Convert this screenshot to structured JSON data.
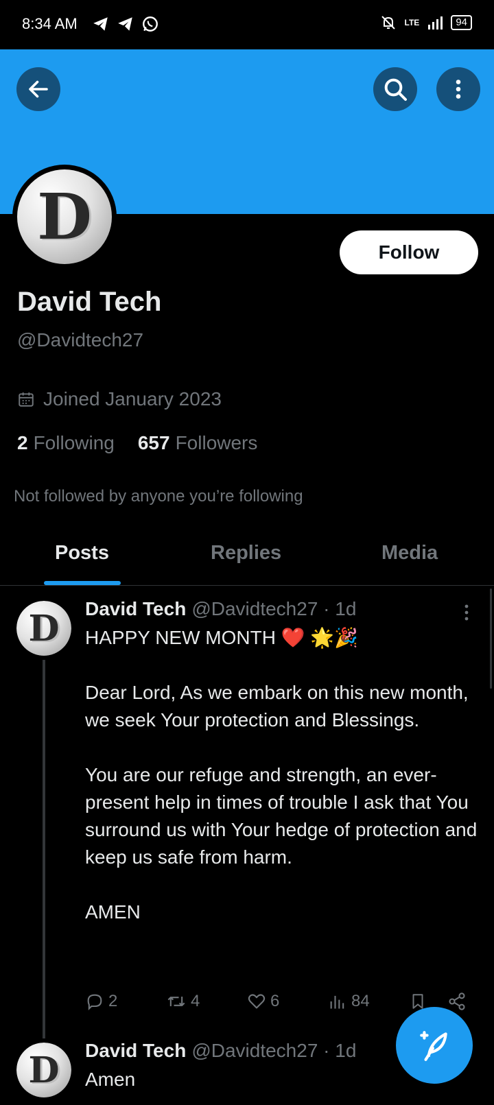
{
  "status_bar": {
    "time": "8:34 AM",
    "left_icons": [
      "telegram-icon",
      "telegram-icon",
      "whatsapp-icon"
    ],
    "right_icons": [
      "notifications-off-icon",
      "lte-signal-icon"
    ],
    "network": "LTE",
    "battery": "94"
  },
  "header": {
    "banner_color": "#1d9bf0",
    "back_icon": "arrow-left-icon",
    "search_icon": "search-icon",
    "more_icon": "more-vertical-icon"
  },
  "profile": {
    "avatar_letter": "D",
    "follow_label": "Follow",
    "name": "David Tech",
    "handle": "@Davidtech27",
    "joined": "Joined January 2023",
    "following_count": "2",
    "following_label": "Following",
    "followers_count": "657",
    "followers_label": "Followers",
    "not_followed": "Not followed by anyone you’re following"
  },
  "tabs": [
    {
      "label": "Posts",
      "active": true
    },
    {
      "label": "Replies",
      "active": false
    },
    {
      "label": "Media",
      "active": false
    }
  ],
  "posts": [
    {
      "name": "David Tech",
      "meta": "@Davidtech27 · 1d",
      "line1": "HAPPY NEW MONTH ❤️ 🌟🎉",
      "para1": "Dear Lord, As we embark on this new month, we seek Your protection and Blessings.",
      "para2": "You are our refuge and strength, an ever-present help in times of trouble  I ask that You surround us with Your hedge of protection and keep us safe from harm.",
      "para3": "AMEN",
      "replies": "2",
      "reposts": "4",
      "likes": "6",
      "views": "84"
    },
    {
      "name": "David Tech",
      "meta": "@Davidtech27 · 1d",
      "text": "Amen"
    }
  ],
  "accent_color": "#1d9bf0",
  "fab_icon": "compose-post-icon"
}
